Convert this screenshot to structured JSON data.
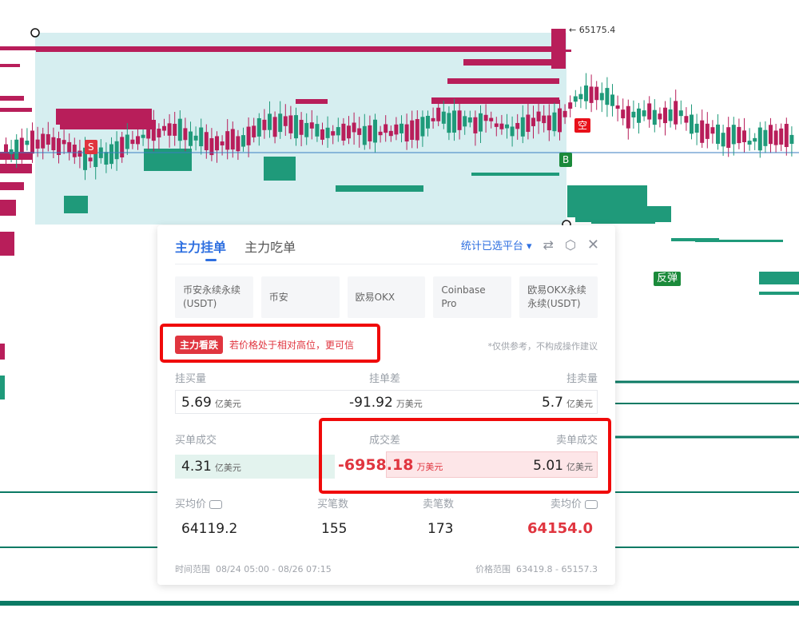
{
  "chart": {
    "top_price_label": "← 65175.4",
    "markers": {
      "s": "S",
      "kong": "空",
      "b": "B",
      "fantan": "反弹"
    },
    "colors": {
      "up": "#1f9a7a",
      "down": "#b81e5a",
      "highlight": "#d6eef0",
      "line": "#0b7a64"
    }
  },
  "panel": {
    "tabs": [
      "主力挂单",
      "主力吃单"
    ],
    "scope": "统计已选平台 ▾",
    "icons": [
      "swap-icon",
      "settings-icon",
      "close-icon"
    ],
    "platforms": [
      "币安永续永续(USDT)",
      "币安",
      "欧易OKX",
      "Coinbase Pro",
      "欧易OKX永续永续(USDT)"
    ],
    "signal": {
      "badge": "主力看跌",
      "text": "若价格处于相对高位，更可信"
    },
    "disclaimer": "*仅供参考，不构成操作建议",
    "row1": {
      "buy_label": "挂买量",
      "diff_label": "挂单差",
      "sell_label": "挂卖量",
      "buy_value": "5.69",
      "buy_unit": "亿美元",
      "diff_value": "-91.92",
      "diff_unit": "万美元",
      "sell_value": "5.7",
      "sell_unit": "亿美元"
    },
    "row2": {
      "buy_label": "买单成交",
      "diff_label": "成交差",
      "sell_label": "卖单成交",
      "buy_value": "4.31",
      "buy_unit": "亿美元",
      "diff_value": "-6958.18",
      "diff_unit": "万美元",
      "sell_value": "5.01",
      "sell_unit": "亿美元"
    },
    "row3": {
      "labels": [
        "买均价",
        "买笔数",
        "卖笔数",
        "卖均价"
      ],
      "values": [
        "64119.2",
        "155",
        "173",
        "64154.0"
      ]
    },
    "footer": {
      "time_label": "时间范围",
      "time_value": "08/24 05:00 - 08/26 07:15",
      "price_label": "价格范围",
      "price_value": "63419.8 - 65157.3"
    }
  }
}
